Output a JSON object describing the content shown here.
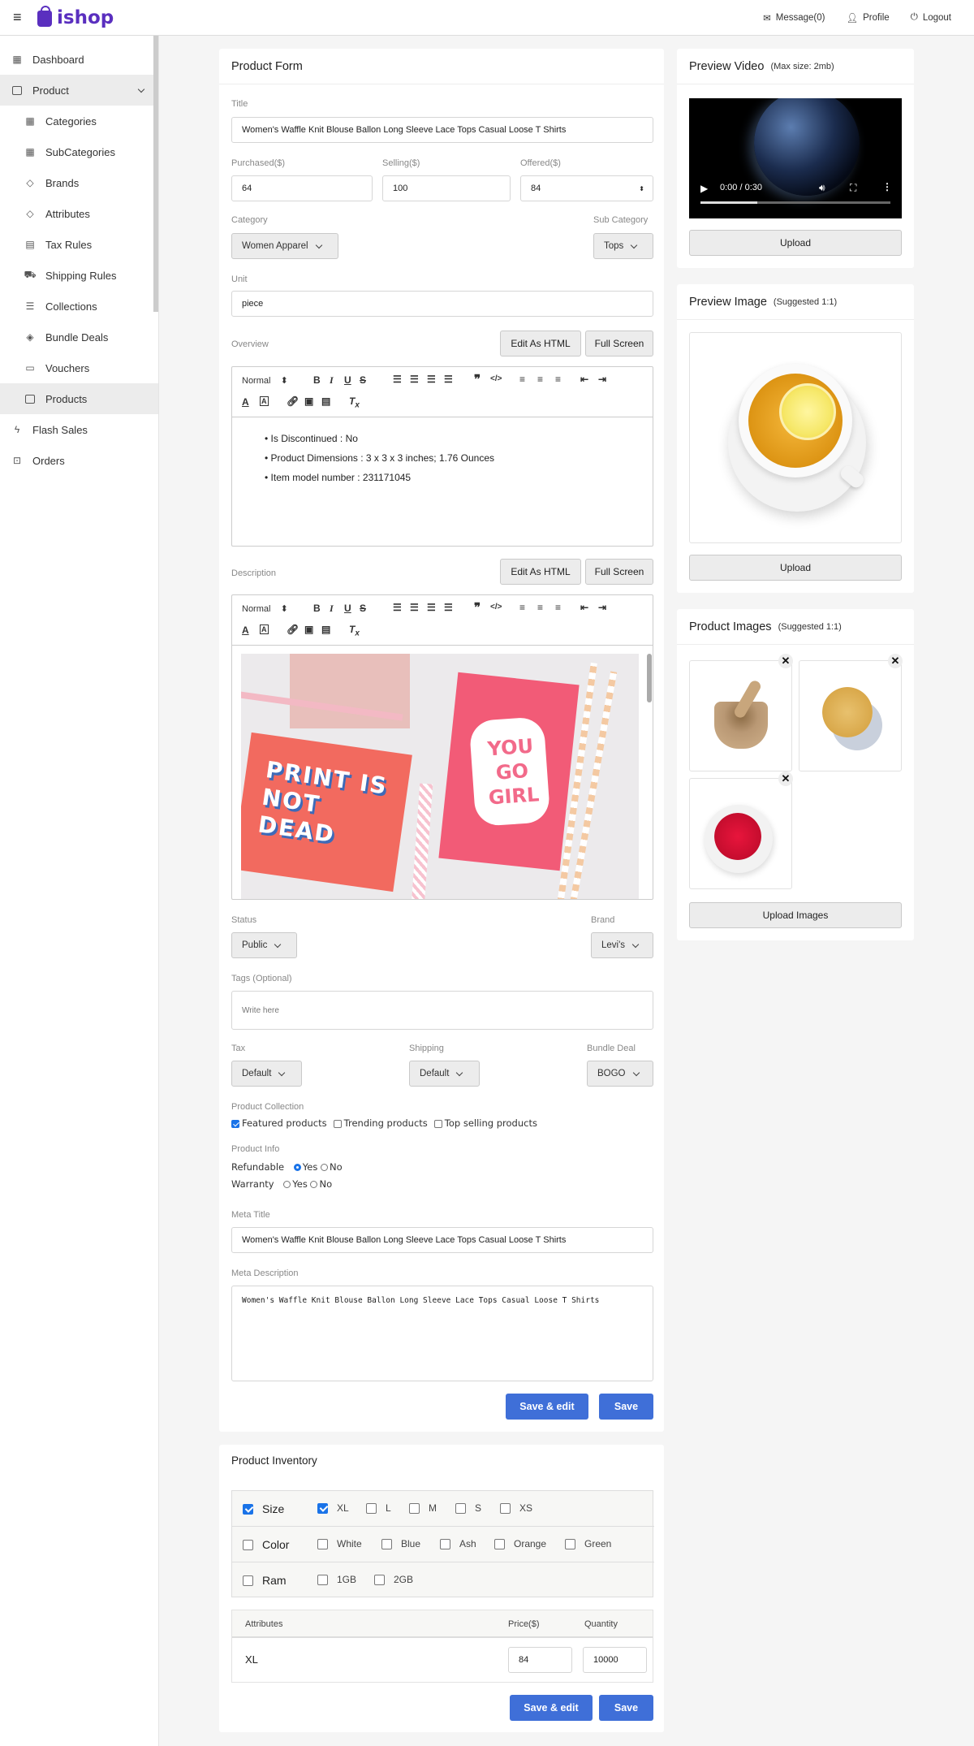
{
  "header": {
    "brand": "ishop",
    "links": [
      {
        "label": "Message(0)",
        "icon": "mail-icon"
      },
      {
        "label": "Profile",
        "icon": "user-icon"
      },
      {
        "label": "Logout",
        "icon": "power-icon"
      }
    ]
  },
  "sidebar": {
    "items": [
      {
        "label": "Dashboard",
        "icon": "dashboard-icon"
      },
      {
        "label": "Product",
        "icon": "box-icon"
      },
      {
        "label": "Categories",
        "icon": "grid-icon"
      },
      {
        "label": "SubCategories",
        "icon": "grid-icon"
      },
      {
        "label": "Brands",
        "icon": "tag-icon"
      },
      {
        "label": "Attributes",
        "icon": "tag-icon"
      },
      {
        "label": "Tax Rules",
        "icon": "file-icon"
      },
      {
        "label": "Shipping Rules",
        "icon": "truck-icon"
      },
      {
        "label": "Collections",
        "icon": "layers-icon"
      },
      {
        "label": "Bundle Deals",
        "icon": "layers-icon"
      },
      {
        "label": "Vouchers",
        "icon": "ticket-icon"
      },
      {
        "label": "Products",
        "icon": "box-icon"
      },
      {
        "label": "Flash Sales",
        "icon": "bolt-icon"
      },
      {
        "label": "Orders",
        "icon": "bag-icon"
      }
    ]
  },
  "form": {
    "title": "Product Form",
    "title_label": "Title",
    "title_value": "Women's Waffle Knit Blouse Ballon Long Sleeve Lace Tops Casual Loose T Shirts",
    "purchased_label": "Purchased($)",
    "purchased_value": "64",
    "selling_label": "Selling($)",
    "selling_value": "100",
    "offered_label": "Offered($)",
    "offered_value": "84",
    "category_label": "Category",
    "category_value": "Women Apparel",
    "subcategory_label": "Sub Category",
    "subcategory_value": "Tops",
    "unit_label": "Unit",
    "unit_value": "piece",
    "overview_label": "Overview",
    "edit_html": "Edit As HTML",
    "full_screen": "Full Screen",
    "editor_format": "Normal",
    "overview_bullets": [
      "Is Discontinued  :  No",
      "Product Dimensions  :  3 x 3 x 3 inches; 1.76 Ounces",
      "Item model number  :  231171045"
    ],
    "description_label": "Description",
    "desc_image_text_1": "PRINT IS NOT DEAD",
    "desc_image_text_2": "YOU GO GIRL",
    "status_label": "Status",
    "status_value": "Public",
    "brand_label": "Brand",
    "brand_value": "Levi's",
    "tags_label": "Tags (Optional)",
    "tags_placeholder": "Write here",
    "tax_label": "Tax",
    "tax_value": "Default",
    "shipping_label": "Shipping",
    "shipping_value": "Default",
    "bundle_label": "Bundle Deal",
    "bundle_value": "BOGO",
    "collection_label": "Product Collection",
    "collections": [
      {
        "label": "Featured products",
        "checked": true
      },
      {
        "label": "Trending products",
        "checked": false
      },
      {
        "label": "Top selling products",
        "checked": false
      }
    ],
    "info_label": "Product Info",
    "refundable_label": "Refundable",
    "warranty_label": "Warranty",
    "yes": "Yes",
    "no": "No",
    "meta_title_label": "Meta Title",
    "meta_title_value": "Women's Waffle Knit Blouse Ballon Long Sleeve Lace Tops Casual Loose T Shirts",
    "meta_desc_label": "Meta Description",
    "meta_desc_value": "Women's Waffle Knit Blouse Ballon Long Sleeve Lace Tops Casual Loose T Shirts",
    "save_edit": "Save & edit",
    "save": "Save"
  },
  "video": {
    "title": "Preview Video",
    "note": "(Max size: 2mb)",
    "time": "0:00 / 0:30",
    "progress": 0.3,
    "upload": "Upload"
  },
  "image": {
    "title": "Preview Image",
    "note": "(Suggested 1:1)",
    "upload": "Upload"
  },
  "gallery": {
    "title": "Product Images",
    "note": "(Suggested 1:1)",
    "upload": "Upload Images"
  },
  "inventory": {
    "title": "Product Inventory",
    "rows": [
      {
        "name": "Size",
        "checked": true,
        "options": [
          {
            "label": "XL",
            "checked": true
          },
          {
            "label": "L",
            "checked": false
          },
          {
            "label": "M",
            "checked": false
          },
          {
            "label": "S",
            "checked": false
          },
          {
            "label": "XS",
            "checked": false
          }
        ]
      },
      {
        "name": "Color",
        "checked": false,
        "options": [
          {
            "label": "White",
            "checked": false
          },
          {
            "label": "Blue",
            "checked": false
          },
          {
            "label": "Ash",
            "checked": false
          },
          {
            "label": "Orange",
            "checked": false
          },
          {
            "label": "Green",
            "checked": false
          }
        ]
      },
      {
        "name": "Ram",
        "checked": false,
        "options": [
          {
            "label": "1GB",
            "checked": false
          },
          {
            "label": "2GB",
            "checked": false
          }
        ]
      }
    ],
    "col_attributes": "Attributes",
    "col_price": "Price($)",
    "col_quantity": "Quantity",
    "row_attr": "XL",
    "row_price": "84",
    "row_qty": "10000",
    "save_edit": "Save & edit",
    "save": "Save"
  },
  "colors": {
    "accent": "#3f6fd8",
    "brand": "#5a2fbf"
  }
}
